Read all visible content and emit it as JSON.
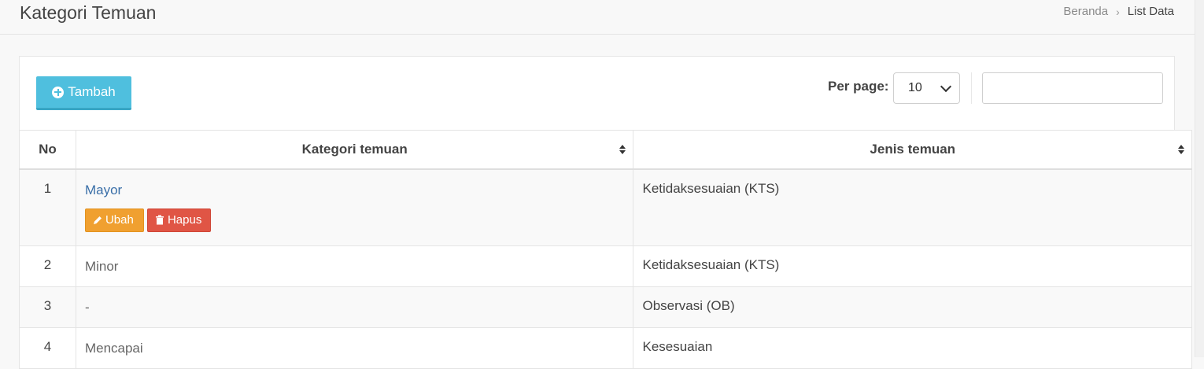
{
  "header": {
    "title": "Kategori Temuan",
    "breadcrumb": {
      "home": "Beranda",
      "current": "List Data"
    }
  },
  "toolbar": {
    "add_label": "Tambah",
    "perpage_label": "Per page:",
    "perpage_value": "10",
    "search_placeholder": ""
  },
  "table": {
    "headers": [
      "No",
      "Kategori temuan",
      "Jenis temuan"
    ],
    "rows": [
      {
        "no": "1",
        "kategori": "Mayor",
        "jenis": "Ketidaksesuaian (KTS)"
      },
      {
        "no": "2",
        "kategori": "Minor",
        "jenis": "Ketidaksesuaian (KTS)"
      },
      {
        "no": "3",
        "kategori": "-",
        "jenis": "Observasi (OB)"
      },
      {
        "no": "4",
        "kategori": "Mencapai",
        "jenis": "Kesesuaian"
      }
    ],
    "row_actions": {
      "edit_label": "Ubah",
      "delete_label": "Hapus"
    }
  },
  "colors": {
    "add_button": "#4fbfde",
    "edit_button": "#f0a030",
    "delete_button": "#e05545",
    "link": "#3a6fa8"
  },
  "icons": [
    "plus-circle-icon",
    "chevron-down-icon",
    "sort-icon",
    "pencil-icon",
    "trash-icon",
    "chevron-right-icon"
  ]
}
